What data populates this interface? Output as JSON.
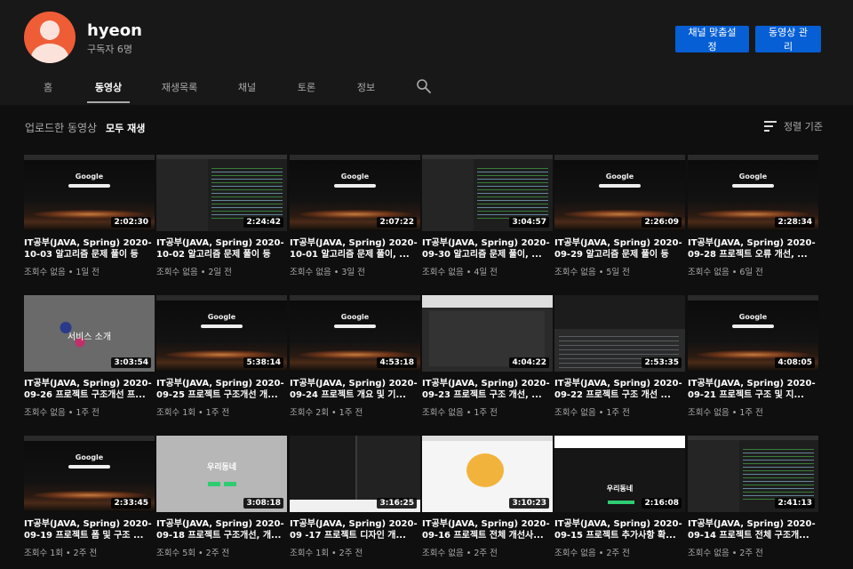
{
  "channel": {
    "name": "hyeon",
    "subscribers": "구독자 6명",
    "avatar_color": "#ef5d37",
    "customize_label": "채널 맞춤설정",
    "manage_label": "동영상 관리"
  },
  "tabs": [
    {
      "label": "홈"
    },
    {
      "label": "동영상"
    },
    {
      "label": "재생목록"
    },
    {
      "label": "채널"
    },
    {
      "label": "토론"
    },
    {
      "label": "정보"
    }
  ],
  "active_tab": "동영상",
  "section": {
    "title": "업로드한 동영상",
    "play_all": "모두 재생",
    "sort_label": "정렬 기준"
  },
  "videos": [
    {
      "title": "IT공부(JAVA, Spring) 2020-10-03 알고리즘 문제 풀이 등",
      "meta": "조회수 없음 • 1일 전",
      "duration": "2:02:30",
      "thumb": "google"
    },
    {
      "title": "IT공부(JAVA, Spring) 2020-10-02 알고리즘 문제 풀이 등",
      "meta": "조회수 없음 • 2일 전",
      "duration": "2:24:42",
      "thumb": "code"
    },
    {
      "title": "IT공부(JAVA, Spring) 2020-10-01 알고리즘 문제 풀이, ...",
      "meta": "조회수 없음 • 3일 전",
      "duration": "2:07:22",
      "thumb": "google"
    },
    {
      "title": "IT공부(JAVA, Spring) 2020-09-30 알고리즘 문제 풀이, ...",
      "meta": "조회수 없음 • 4일 전",
      "duration": "3:04:57",
      "thumb": "code"
    },
    {
      "title": "IT공부(JAVA, Spring) 2020-09-29 알고리즘 문제 풀이 등",
      "meta": "조회수 없음 • 5일 전",
      "duration": "2:26:09",
      "thumb": "google"
    },
    {
      "title": "IT공부(JAVA, Spring) 2020-09-28 프로젝트 오류 개선, ...",
      "meta": "조회수 없음 • 6일 전",
      "duration": "2:28:34",
      "thumb": "google"
    },
    {
      "title": "IT공부(JAVA, Spring) 2020-09-26 프로젝트 구조개선 프...",
      "meta": "조회수 없음 • 1주 전",
      "duration": "3:03:54",
      "thumb": "gray",
      "overlay": "서비스 소개"
    },
    {
      "title": "IT공부(JAVA, Spring) 2020-09-25 프로젝트 구조개선 개...",
      "meta": "조회수 1회 • 1주 전",
      "duration": "5:38:14",
      "thumb": "google"
    },
    {
      "title": "IT공부(JAVA, Spring) 2020-09-24 프로젝트 개요 및 기...",
      "meta": "조회수 2회 • 1주 전",
      "duration": "4:53:18",
      "thumb": "google"
    },
    {
      "title": "IT공부(JAVA, Spring) 2020-09-23 프로젝트 구조 개선, ...",
      "meta": "조회수 없음 • 1주 전",
      "duration": "4:04:22",
      "thumb": "web"
    },
    {
      "title": "IT공부(JAVA, Spring) 2020-09-22 프로젝트 구조 개선 ...",
      "meta": "조회수 없음 • 1주 전",
      "duration": "2:53:35",
      "thumb": "ide"
    },
    {
      "title": "IT공부(JAVA, Spring) 2020-09-21 프로젝트 구조 및 지...",
      "meta": "조회수 없음 • 1주 전",
      "duration": "4:08:05",
      "thumb": "google"
    },
    {
      "title": "IT공부(JAVA, Spring) 2020-09-19 프로젝트 폼 및 구조 ...",
      "meta": "조회수 1회 • 2주 전",
      "duration": "2:33:45",
      "thumb": "google"
    },
    {
      "title": "IT공부(JAVA, Spring) 2020-09-18 프로젝트 구조개선, 개...",
      "meta": "조회수 5회 • 2주 전",
      "duration": "3:08:18",
      "thumb": "light",
      "overlay": "우리동네"
    },
    {
      "title": "IT공부(JAVA, Spring) 2020-09 -17 프로젝트 디자인 개...",
      "meta": "조회수 1회 • 2주 전",
      "duration": "3:16:25",
      "thumb": "movie"
    },
    {
      "title": "IT공부(JAVA, Spring) 2020-09-16 프로젝트 전체 개선사...",
      "meta": "조회수 없음 • 2주 전",
      "duration": "3:10:23",
      "thumb": "kakao"
    },
    {
      "title": "IT공부(JAVA, Spring) 2020-09-15 프로젝트 추가사항 확...",
      "meta": "조회수 없음 • 2주 전",
      "duration": "2:16:08",
      "thumb": "darkapp",
      "overlay": "우리동네"
    },
    {
      "title": "IT공부(JAVA, Spring) 2020-09-14 프로젝트 전체 구조개...",
      "meta": "조회수 없음 • 2주 전",
      "duration": "2:41:13",
      "thumb": "code"
    }
  ],
  "google_logo_text": "Google"
}
